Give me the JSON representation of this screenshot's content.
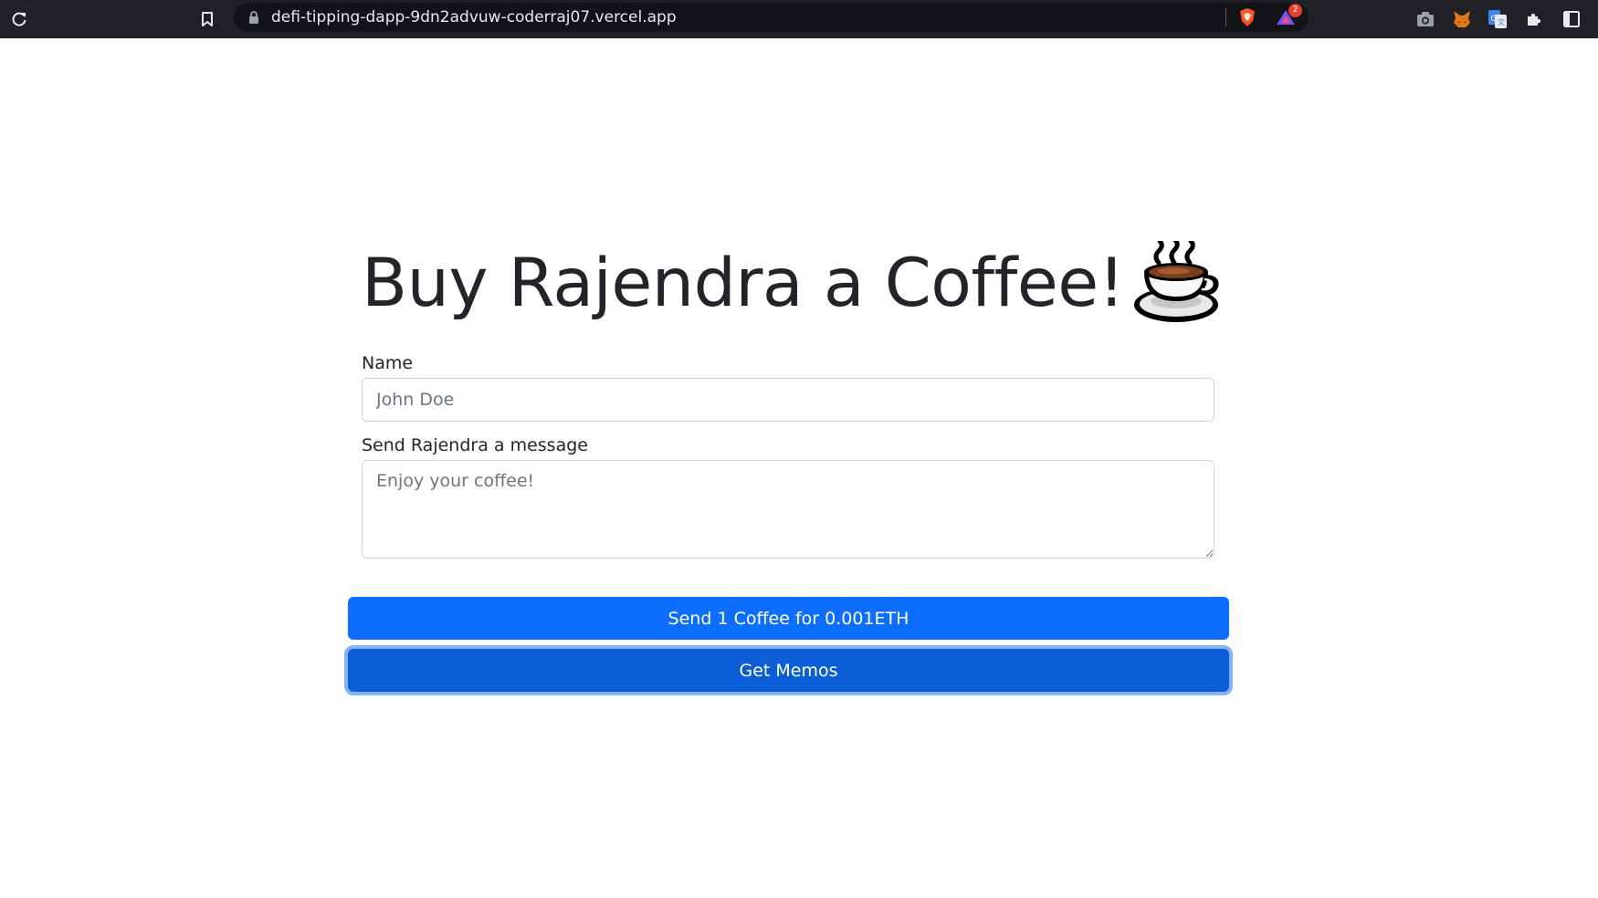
{
  "browser": {
    "url": "defi-tipping-dapp-9dn2advuw-coderraj07.vercel.app",
    "alerts_badge": "2",
    "icons": [
      "reload-icon",
      "bookmark-icon",
      "lock-icon",
      "brave-shield-icon",
      "brave-rewards-icon",
      "camera-icon",
      "metamask-icon",
      "google-translate-icon",
      "extensions-icon",
      "sidebar-icon"
    ]
  },
  "page": {
    "title": "Buy Rajendra a Coffee!",
    "title_emoji": "coffee-cup-emoji"
  },
  "form": {
    "name_label": "Name",
    "name_placeholder": "John Doe",
    "name_value": "",
    "message_label": "Send Rajendra a message",
    "message_placeholder": "Enjoy your coffee!",
    "message_value": ""
  },
  "buttons": {
    "send_label": "Send 1 Coffee for 0.001ETH",
    "memos_label": "Get Memos"
  },
  "colors": {
    "primary": "#0d6efd",
    "primary_active": "#0b5ed7",
    "text": "#212529",
    "toolbar": "#202124"
  }
}
